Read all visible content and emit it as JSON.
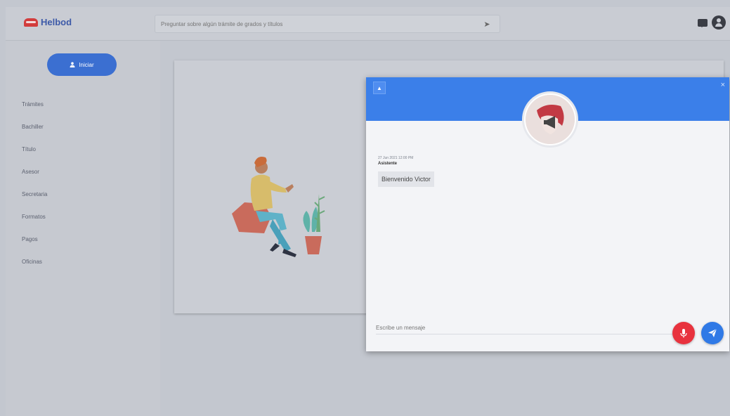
{
  "app": {
    "logo_text": "Helbod"
  },
  "search": {
    "placeholder": "Preguntar sobre algún trámite de grados y títulos",
    "search_icon": "send-icon"
  },
  "header": {
    "icons": [
      "chat-icon",
      "user-icon"
    ]
  },
  "sidebar": {
    "login_label": "Iniciar",
    "items": [
      {
        "label": "Trámites"
      },
      {
        "label": "Bachiller"
      },
      {
        "label": "Título"
      },
      {
        "label": "Asesor"
      },
      {
        "label": "Secretaria"
      },
      {
        "label": "Formatos"
      },
      {
        "label": "Pagos"
      },
      {
        "label": "Oficinas"
      }
    ]
  },
  "chat": {
    "message": {
      "timestamp": "27 Jun 2021 12:00 PM",
      "author": "Asistente",
      "text": "Bienvenido Victor"
    },
    "input_placeholder": "Escribe un mensaje",
    "close_label": "×",
    "minimize_label": "▲"
  },
  "colors": {
    "accent": "#3b7fe9",
    "mic": "#e8323e",
    "send": "#2f79e6",
    "login": "#3b6fd1"
  }
}
